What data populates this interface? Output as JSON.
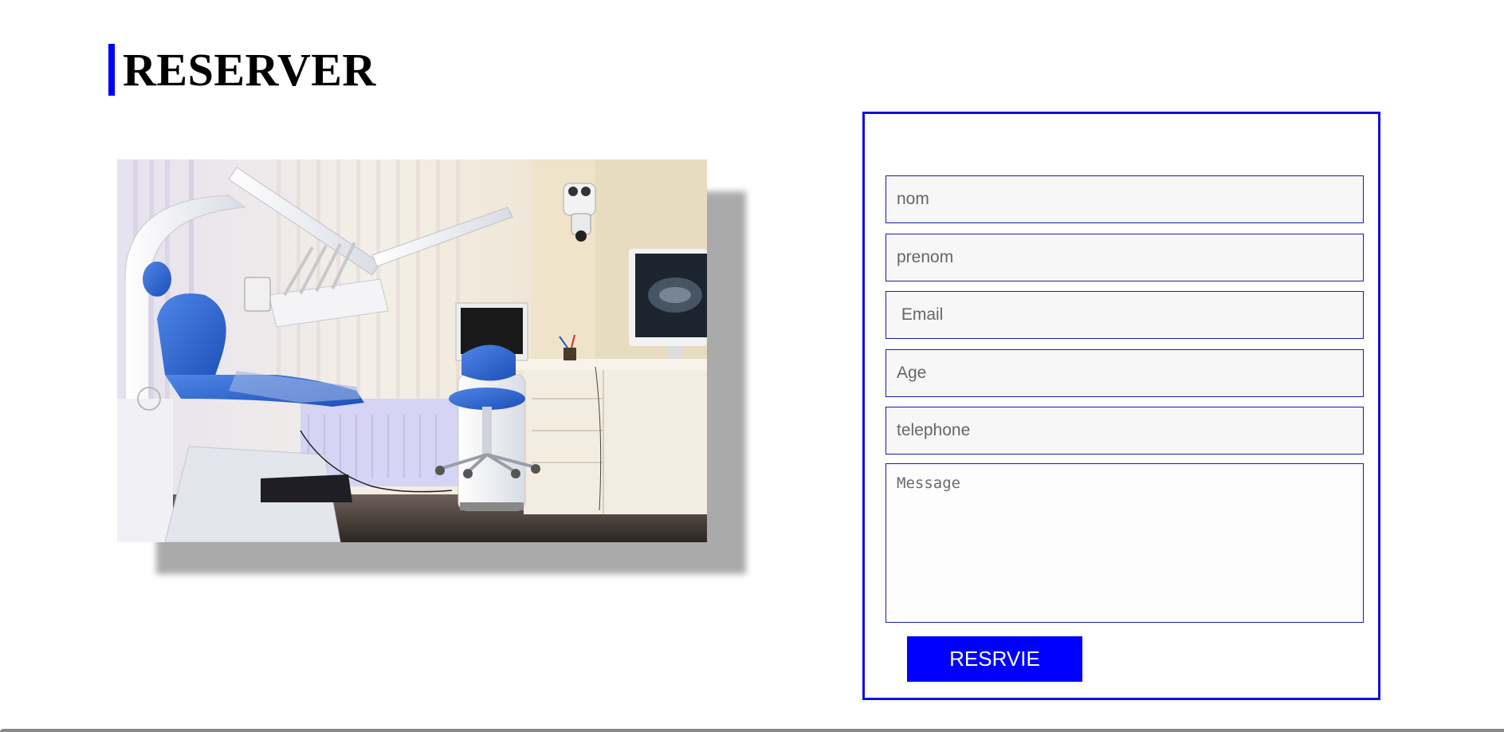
{
  "heading": {
    "title": "RESERVER",
    "accent_color": "#0000ff"
  },
  "photo": {
    "alt": "dental-office-photo",
    "icon_names": [
      "dental-chair",
      "monitor",
      "stool",
      "microscope"
    ]
  },
  "form": {
    "border_color": "#1010e0",
    "fields": {
      "nom": {
        "placeholder": "nom",
        "value": ""
      },
      "prenom": {
        "placeholder": "prenom",
        "value": ""
      },
      "email": {
        "placeholder": " Email",
        "value": ""
      },
      "age": {
        "placeholder": "Age",
        "value": ""
      },
      "telephone": {
        "placeholder": "telephone",
        "value": ""
      },
      "message": {
        "placeholder": "Message",
        "value": ""
      }
    },
    "submit_label": "RESRVIE",
    "submit_color": "#0000ff"
  }
}
